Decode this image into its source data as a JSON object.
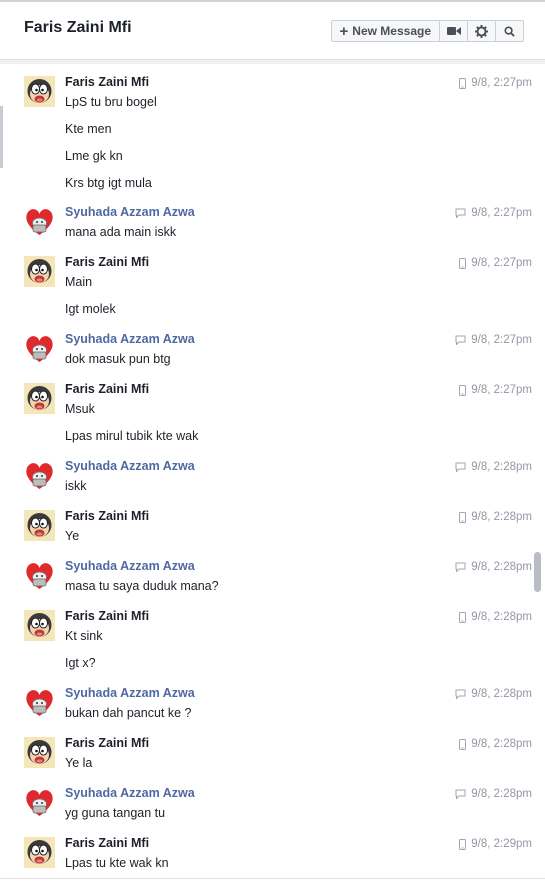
{
  "header": {
    "title": "Faris Zaini Mfi",
    "new_message_label": "New Message"
  },
  "icons": {
    "phone": "mobile-phone-icon",
    "chat": "chat-bubble-icon",
    "video": "video-camera-icon",
    "settings": "gear-icon",
    "search": "search-icon"
  },
  "colors": {
    "sender_link": "#4e69a2",
    "timestamp": "#9197a3"
  },
  "messages": [
    {
      "sender": "Faris Zaini Mfi",
      "time": "9/8, 2:27pm",
      "lines": [
        "LpS tu bru bogel",
        "Kte men",
        "Lme gk kn",
        "Krs btg igt mula"
      ]
    },
    {
      "sender": "Syuhada Azzam Azwa",
      "time": "9/8, 2:27pm",
      "lines": [
        "mana ada main iskk"
      ]
    },
    {
      "sender": "Faris Zaini Mfi",
      "time": "9/8, 2:27pm",
      "lines": [
        "Main",
        "Igt molek"
      ]
    },
    {
      "sender": "Syuhada Azzam Azwa",
      "time": "9/8, 2:27pm",
      "lines": [
        "dok masuk pun btg"
      ]
    },
    {
      "sender": "Faris Zaini Mfi",
      "time": "9/8, 2:27pm",
      "lines": [
        "Msuk",
        "Lpas mirul tubik kte wak"
      ]
    },
    {
      "sender": "Syuhada Azzam Azwa",
      "time": "9/8, 2:28pm",
      "lines": [
        "iskk"
      ]
    },
    {
      "sender": "Faris Zaini Mfi",
      "time": "9/8, 2:28pm",
      "lines": [
        "Ye"
      ]
    },
    {
      "sender": "Syuhada Azzam Azwa",
      "time": "9/8, 2:28pm",
      "lines": [
        "masa tu saya duduk mana?"
      ]
    },
    {
      "sender": "Faris Zaini Mfi",
      "time": "9/8, 2:28pm",
      "lines": [
        "Kt sink",
        "Igt x?"
      ]
    },
    {
      "sender": "Syuhada Azzam Azwa",
      "time": "9/8, 2:28pm",
      "lines": [
        "bukan dah pancut ke ?"
      ]
    },
    {
      "sender": "Faris Zaini Mfi",
      "time": "9/8, 2:28pm",
      "lines": [
        "Ye la"
      ]
    },
    {
      "sender": "Syuhada Azzam Azwa",
      "time": "9/8, 2:28pm",
      "lines": [
        "yg guna tangan tu"
      ]
    },
    {
      "sender": "Faris Zaini Mfi",
      "time": "9/8, 2:29pm",
      "lines": [
        "Lpas tu kte wak kn"
      ]
    }
  ]
}
